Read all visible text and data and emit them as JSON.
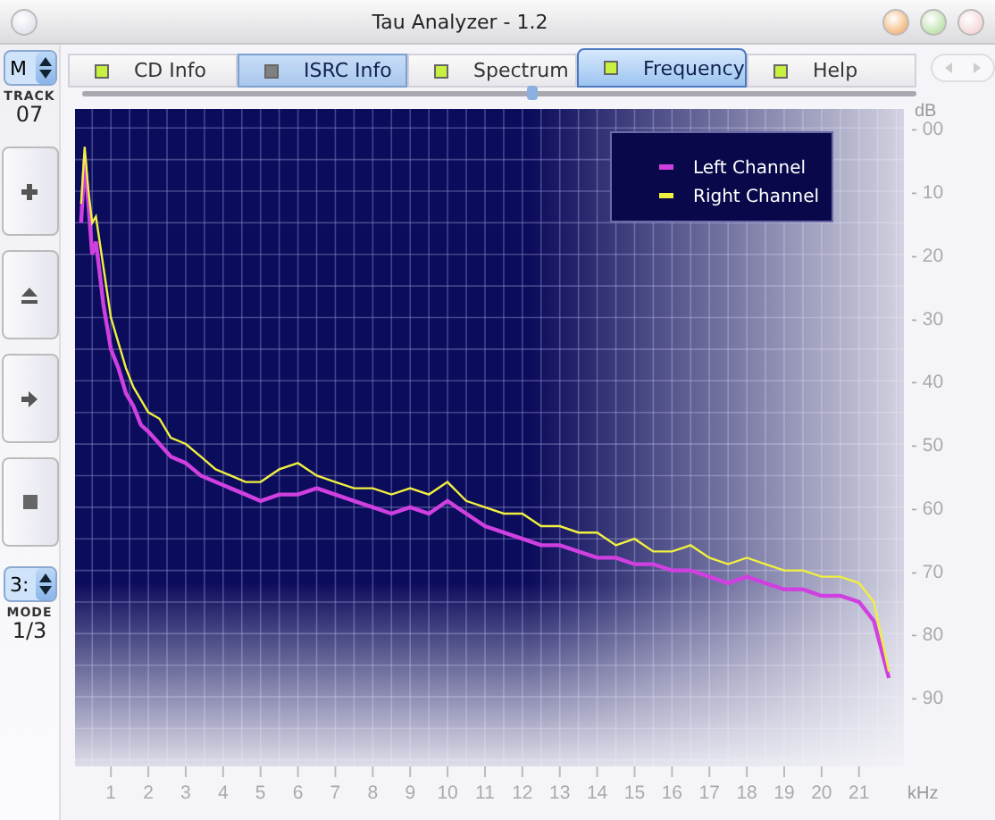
{
  "window": {
    "title": "Tau Analyzer - 1.2"
  },
  "left_panel": {
    "channel_select": "M",
    "track_label": "TRACK",
    "track": "07",
    "buttons": [
      {
        "kind": "plus"
      },
      {
        "kind": "eject"
      },
      {
        "kind": "next"
      },
      {
        "kind": "stop"
      }
    ],
    "mode_select": "3:",
    "mode_label": "MODE",
    "mode": "1/3"
  },
  "tabs": [
    {
      "label": "CD Info",
      "selected": false,
      "color": "#c8f040"
    },
    {
      "label": "ISRC Info",
      "selected": false,
      "highlighted": true,
      "color": "#808080"
    },
    {
      "label": "Spectrum",
      "selected": false,
      "color": "#c8f040"
    },
    {
      "label": "Frequency",
      "selected": true,
      "color": "#c8f040"
    },
    {
      "label": "Help",
      "selected": false,
      "color": "#c8f040"
    }
  ],
  "position_slider": {
    "level": 0.54
  },
  "chart_data": {
    "type": "line",
    "xlabel": "kHz",
    "ylabel": "dB",
    "x": [
      0.2,
      0.3,
      0.4,
      0.5,
      0.6,
      0.8,
      1.0,
      1.2,
      1.4,
      1.6,
      1.8,
      2.0,
      2.3,
      2.6,
      3.0,
      3.4,
      3.8,
      4.2,
      4.6,
      5.0,
      5.5,
      6.0,
      6.5,
      7.0,
      7.5,
      8.0,
      8.5,
      9.0,
      9.5,
      10.0,
      10.5,
      11.0,
      11.5,
      12.0,
      12.5,
      13.0,
      13.5,
      14.0,
      14.5,
      15.0,
      15.5,
      16.0,
      16.5,
      17.0,
      17.5,
      18.0,
      18.5,
      19.0,
      19.5,
      20.0,
      20.5,
      21.0,
      21.4,
      21.8
    ],
    "series": [
      {
        "name": "Left Channel",
        "color": "#d040e0",
        "values": [
          -15,
          -5,
          -12,
          -20,
          -18,
          -28,
          -35,
          -38,
          -42,
          -44,
          -47,
          -48,
          -50,
          -52,
          -53,
          -55,
          -56,
          -57,
          -58,
          -59,
          -58,
          -58,
          -57,
          -58,
          -59,
          -60,
          -61,
          -60,
          -61,
          -59,
          -61,
          -63,
          -64,
          -65,
          -66,
          -66,
          -67,
          -68,
          -68,
          -69,
          -69,
          -70,
          -70,
          -71,
          -72,
          -71,
          -72,
          -73,
          -73,
          -74,
          -74,
          -75,
          -78,
          -87
        ]
      },
      {
        "name": "Right Channel",
        "color": "#f0f040",
        "values": [
          -12,
          -3,
          -10,
          -15,
          -14,
          -22,
          -30,
          -34,
          -38,
          -41,
          -43,
          -45,
          -46,
          -49,
          -50,
          -52,
          -54,
          -55,
          -56,
          -56,
          -54,
          -53,
          -55,
          -56,
          -57,
          -57,
          -58,
          -57,
          -58,
          -56,
          -59,
          -60,
          -61,
          -61,
          -63,
          -63,
          -64,
          -64,
          -66,
          -65,
          -67,
          -67,
          -66,
          -68,
          -69,
          -68,
          -69,
          -70,
          -70,
          -71,
          -71,
          -72,
          -75,
          -86
        ]
      }
    ],
    "grid": true,
    "legend": true,
    "xlim": [
      0.04,
      22.2
    ],
    "ylim": [
      -101,
      3
    ],
    "xticks": [
      1,
      2,
      3,
      4,
      5,
      6,
      7,
      8,
      9,
      10,
      11,
      12,
      13,
      14,
      15,
      16,
      17,
      18,
      19,
      20,
      21
    ],
    "yticks": [
      {
        "value": 0,
        "label": "- 00"
      },
      {
        "value": -10,
        "label": "- 10"
      },
      {
        "value": -20,
        "label": "- 20"
      },
      {
        "value": -30,
        "label": "- 30"
      },
      {
        "value": -40,
        "label": "- 40"
      },
      {
        "value": -50,
        "label": "- 50"
      },
      {
        "value": -60,
        "label": "- 60"
      },
      {
        "value": -70,
        "label": "- 70"
      },
      {
        "value": -80,
        "label": "- 80"
      },
      {
        "value": -90,
        "label": "- 90"
      }
    ]
  }
}
